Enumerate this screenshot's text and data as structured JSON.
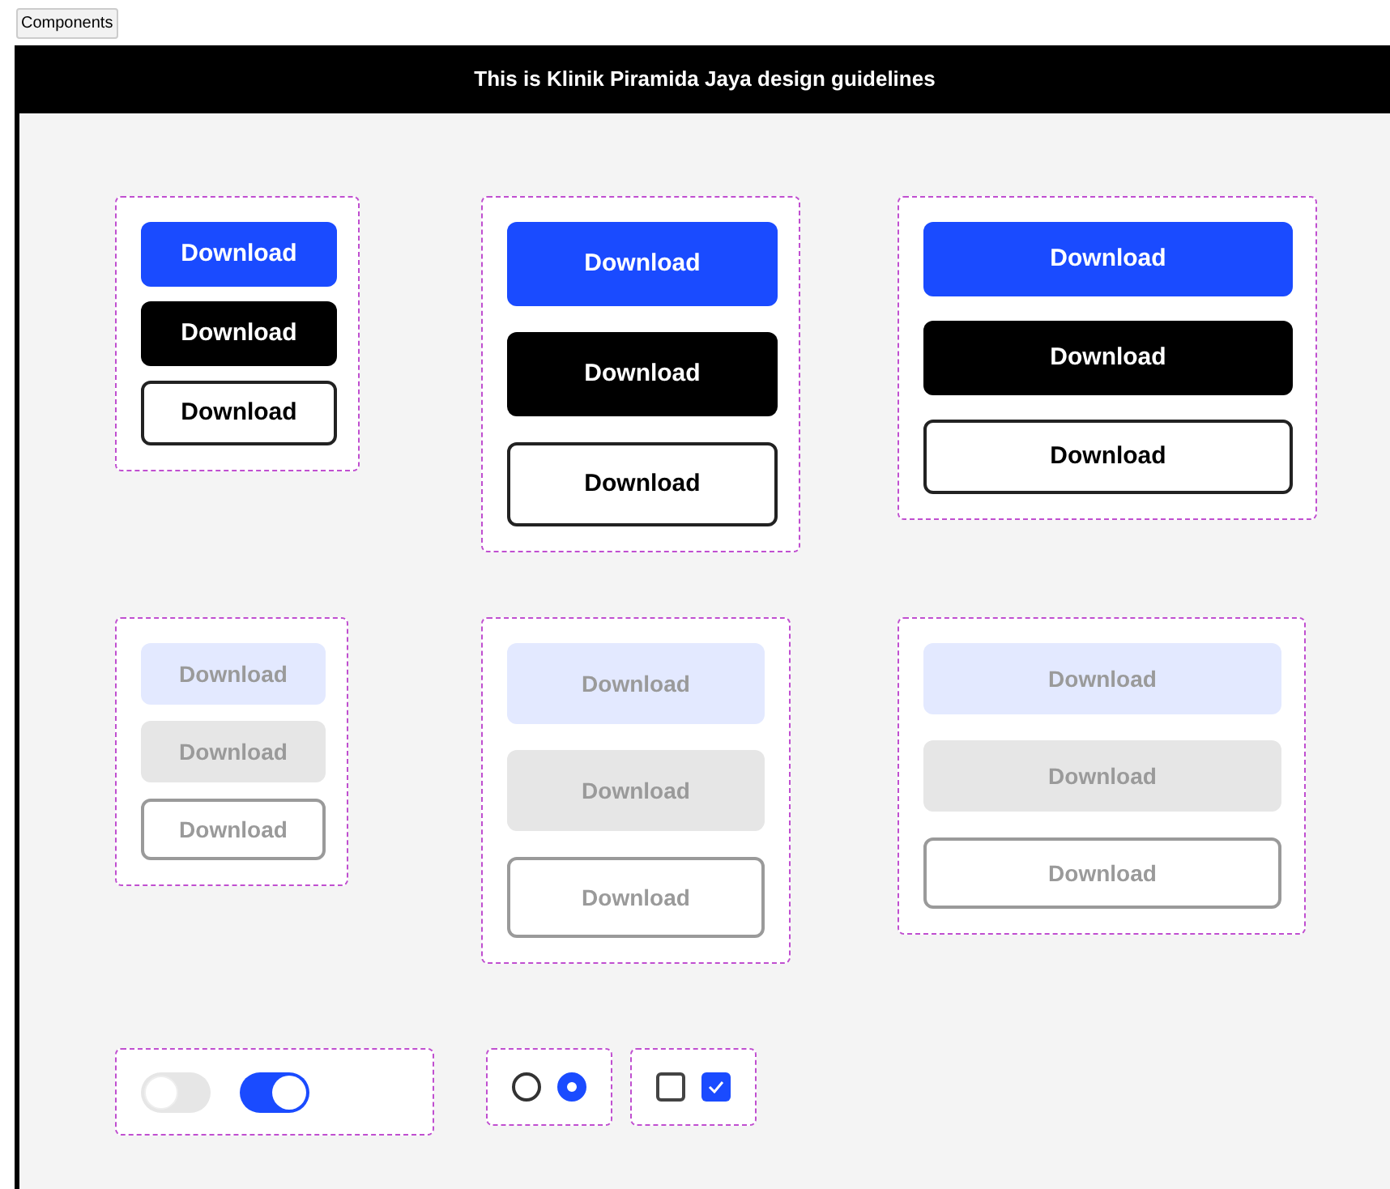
{
  "top_button": "Components",
  "header": {
    "title": "This is Klinik Piramida Jaya design guidelines"
  },
  "button_groups": [
    {
      "disabled": false,
      "buttons": [
        {
          "label": "Download",
          "kind": "primary"
        },
        {
          "label": "Download",
          "kind": "dark"
        },
        {
          "label": "Download",
          "kind": "outline"
        }
      ]
    },
    {
      "disabled": false,
      "buttons": [
        {
          "label": "Download",
          "kind": "primary"
        },
        {
          "label": "Download",
          "kind": "dark"
        },
        {
          "label": "Download",
          "kind": "outline"
        }
      ]
    },
    {
      "disabled": false,
      "buttons": [
        {
          "label": "Download",
          "kind": "primary"
        },
        {
          "label": "Download",
          "kind": "dark"
        },
        {
          "label": "Download",
          "kind": "outline"
        }
      ]
    },
    {
      "disabled": true,
      "buttons": [
        {
          "label": "Download",
          "kind": "primary"
        },
        {
          "label": "Download",
          "kind": "dark"
        },
        {
          "label": "Download",
          "kind": "outline"
        }
      ]
    },
    {
      "disabled": true,
      "buttons": [
        {
          "label": "Download",
          "kind": "primary"
        },
        {
          "label": "Download",
          "kind": "dark"
        },
        {
          "label": "Download",
          "kind": "outline"
        }
      ]
    },
    {
      "disabled": true,
      "buttons": [
        {
          "label": "Download",
          "kind": "primary"
        },
        {
          "label": "Download",
          "kind": "dark"
        },
        {
          "label": "Download",
          "kind": "outline"
        }
      ]
    }
  ],
  "toggles": [
    {
      "on": false
    },
    {
      "on": true
    }
  ],
  "radios": [
    {
      "selected": false
    },
    {
      "selected": true
    }
  ],
  "checkboxes": [
    {
      "checked": false
    },
    {
      "checked": true
    }
  ]
}
